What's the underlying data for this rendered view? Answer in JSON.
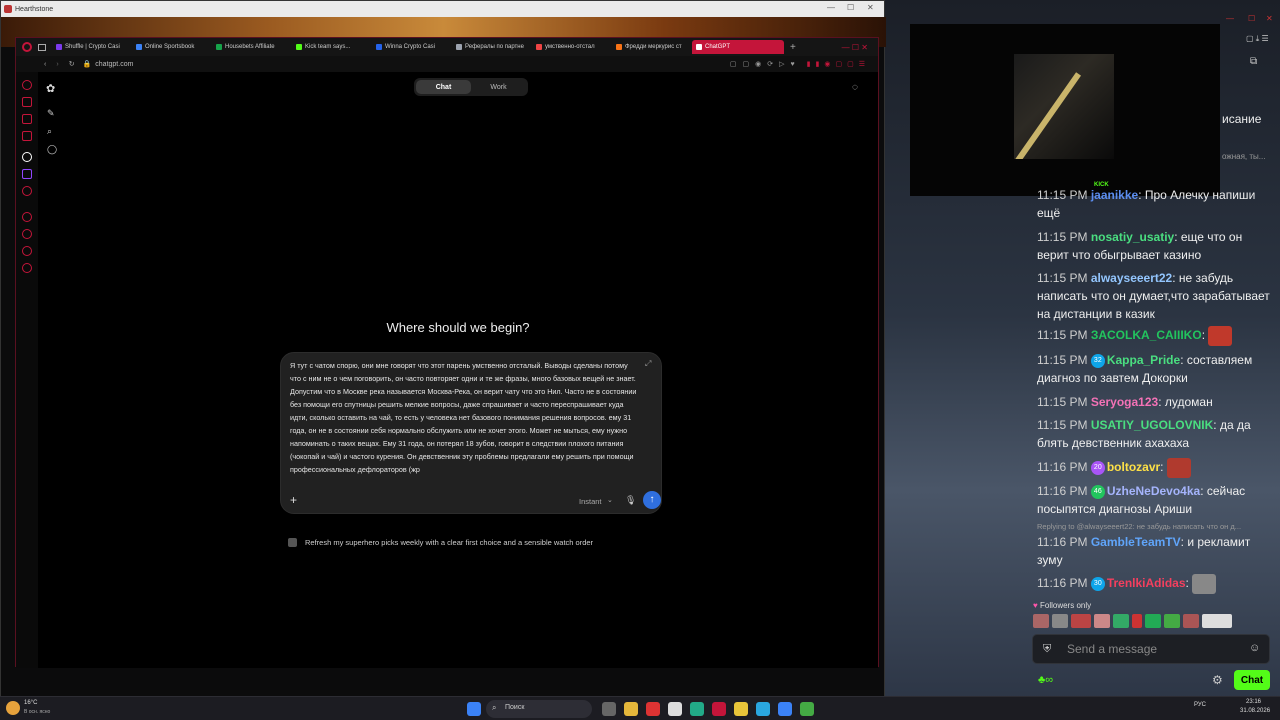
{
  "hearthstone": {
    "title": "Hearthstone"
  },
  "browser": {
    "tabs": [
      {
        "label": "Shuffle | Crypto Casi",
        "color": "#7c3aed"
      },
      {
        "label": "Online Sportsbook",
        "color": "#3b82f6"
      },
      {
        "label": "Housebets Affiliate",
        "color": "#16a34a"
      },
      {
        "label": "Kick team says...",
        "color": "#53fc18"
      },
      {
        "label": "Winna Crypto Casi",
        "color": "#2563eb"
      },
      {
        "label": "Рефералы по партне",
        "color": "#9ca3af"
      },
      {
        "label": "умственно-отстал",
        "color": "#ef4444"
      },
      {
        "label": "Фредди меркурис ст",
        "color": "#f97316"
      },
      {
        "label": "ChatGPT",
        "color": "#c4153a",
        "active": true
      }
    ],
    "url": "chatgpt.com"
  },
  "chatgpt": {
    "segments": {
      "chat": "Chat",
      "work": "Work"
    },
    "heading": "Where should we begin?",
    "composer_text": "Я тут с чатом спорю, они мне говорят что этот парень умственно отсталый. Выводы сделаны потому что с ним не о чем поговорить, он часто повторяет одни и те же фразы, много базовых вещей не знает. Допустим что в Москве река называется Москва-Река, он верит чату что это Нил. Часто не в состоянии без помощи его спутницы решить мелкие вопросы, даже спрашивает и часто переспрашивает куда идти, сколько оставить на чай, то есть у человека нет базового понимания решения вопросов. ему 31 года, он не в состоянии себя нормально обслужить или не хочет этого. Может не мыться, ему нужно напоминать о таких вещах. Ему 31 года, он потерял 18 зубов, говорит в следствии плохого питания (чокопай и чай) и частого курения. Он девственник эту проблемы предлагали ему решить при помощи профессиональных дефлораторов (жр",
    "model_select": "Instant",
    "suggestion": "Refresh my superhero picks weekly with a clear first choice and a sensible watch order"
  },
  "stream": {
    "kick_label": "KICK",
    "partial_top": "исание",
    "partial_top2": "ожная, ты...",
    "messages": [
      {
        "time": "11:15 PM",
        "user": "jaanikke",
        "text": "Про Алечку напиши ещё",
        "color": "#5b8def"
      },
      {
        "time": "11:15 PM",
        "user": "nosatiy_usatiy",
        "text": "еще что он верит что обыгрывает казино",
        "color": "#4ade80"
      },
      {
        "time": "11:15 PM",
        "user": "alwayseeert22",
        "text": "не забудь написать что он думает,что зарабатывает на дистанции в казик",
        "color": "#93c5fd"
      },
      {
        "time": "11:15 PM",
        "user": "ЗACOLKA_CAIIIKO",
        "text": "",
        "color": "#22c55e",
        "emote": "#c0392b"
      },
      {
        "time": "11:15 PM",
        "user": "Kappa_Pride",
        "text": "составляем диагноз по завтем Докорки",
        "color": "#4ade80",
        "badge": "32",
        "badge_color": "#0ea5e9"
      },
      {
        "time": "11:15 PM",
        "user": "Seryoga123",
        "text": "лудоман",
        "color": "#f472b6"
      },
      {
        "time": "11:15 PM",
        "user": "USATIY_UGOLOVNIK",
        "text": "да да блять девственник ахахаха",
        "color": "#4ade80"
      },
      {
        "time": "11:16 PM",
        "user": "boltozavr",
        "text": "",
        "color": "#fde047",
        "badge": "20",
        "badge_color": "#a855f7",
        "emote": "#b03a2e"
      },
      {
        "time": "11:16 PM",
        "user": "UzheNeDevo4ka",
        "text": "сейчас посыпятся диагнозы Ариши",
        "color": "#a5b4fc",
        "badge": "46",
        "badge_color": "#22c55e"
      },
      {
        "time": "11:16 PM",
        "user": "GambleTeamTV",
        "text": "и рекламит зуму",
        "color": "#60a5fa",
        "reply": "Replying to @alwayseeert22: не забудь написать что он д..."
      },
      {
        "time": "11:16 PM",
        "user": "TrenlkiAdidas",
        "text": "",
        "color": "#f43f5e",
        "badge": "30",
        "badge_color": "#0ea5e9",
        "emote": "#888888"
      }
    ],
    "followers_only": "Followers only",
    "input_placeholder": "Send a message",
    "chat_button": "Chat"
  },
  "taskbar": {
    "weather_temp": "16°C",
    "weather_desc": "В осн. ясно",
    "search": "Поиск",
    "lang": "РУС",
    "time": "23:16",
    "date": "31.08.2026"
  }
}
